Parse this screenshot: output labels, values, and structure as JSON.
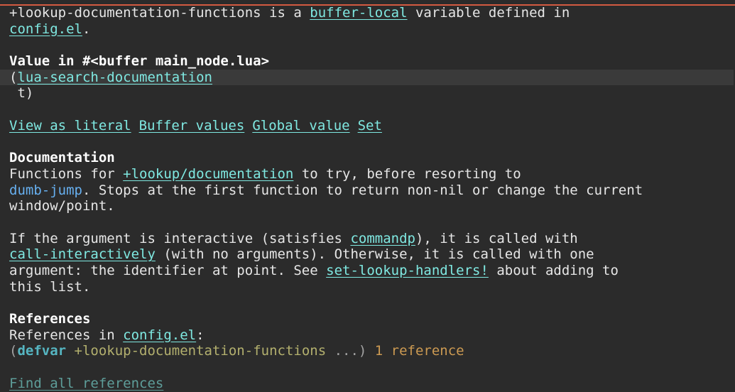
{
  "intro": {
    "variable": "+lookup-documentation-functions",
    "text1": " is a ",
    "buffer_local_link": "buffer-local",
    "text2": " variable defined in",
    "config_link": "config.el",
    "period": "."
  },
  "value": {
    "heading": "Value in #<buffer main_node.lua>",
    "open_paren": "(",
    "item1": "lua-search-documentation",
    "item2": " t)"
  },
  "buttons": {
    "view_literal": "View as literal",
    "buffer_values": "Buffer values",
    "global_value": "Global value",
    "set": "Set"
  },
  "documentation": {
    "heading": "Documentation",
    "p1_l1_a": "Functions for ",
    "p1_l1_link": "+lookup/documentation",
    "p1_l1_b": " to try, before resorting to",
    "p1_l2_link": "dumb-jump",
    "p1_l2_b": ". Stops at the first function to return non-nil or change the current",
    "p1_l3": "window/point.",
    "p2_l1_a": "If the argument is interactive (satisfies ",
    "p2_l1_link": "commandp",
    "p2_l1_b": "), it is called with",
    "p2_l2_link": "call-interactively",
    "p2_l2_b": " (with no arguments). Otherwise, it is called with one",
    "p2_l3_a": "argument: the identifier at point. See ",
    "p2_l3_link": "set-lookup-handlers!",
    "p2_l3_b": " about adding to",
    "p2_l4": "this list."
  },
  "references": {
    "heading": "References",
    "label": "References in ",
    "file_link": "config.el",
    "colon": ":",
    "open_paren": "(",
    "keyword": "defvar",
    "symbol": " +lookup-documentation-functions",
    "ellipsis": " ...)",
    "count": " 1 reference",
    "find_all": "Find all references"
  },
  "colors": {
    "link": "#7fe8e1",
    "background": "#2b2b2b",
    "accent_border": "#d35a41"
  }
}
